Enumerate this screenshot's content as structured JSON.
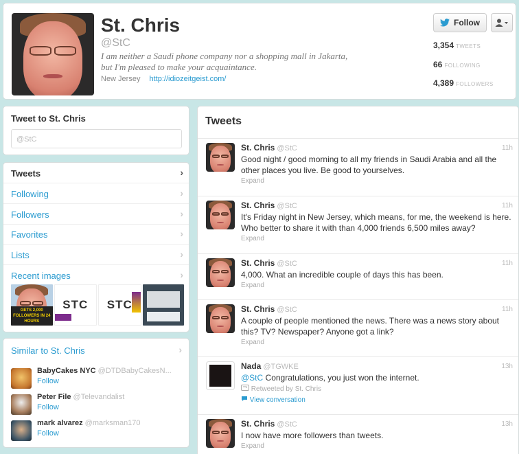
{
  "profile": {
    "name": "St. Chris",
    "handle": "@StC",
    "bio_line1": "I am neither a Saudi phone company nor a shopping mall in Jakarta,",
    "bio_line2": "but I'm pleased to make your acquaintance.",
    "location": "New Jersey",
    "url": "http://idiozeitgeist.com/",
    "follow_label": "Follow",
    "stats": [
      {
        "num": "3,354",
        "label": "TWEETS"
      },
      {
        "num": "66",
        "label": "FOLLOWING"
      },
      {
        "num": "4,389",
        "label": "FOLLOWERS"
      }
    ]
  },
  "tweet_to": {
    "title": "Tweet to St. Chris",
    "placeholder": "@StC"
  },
  "nav": {
    "items": [
      {
        "label": "Tweets"
      },
      {
        "label": "Following"
      },
      {
        "label": "Followers"
      },
      {
        "label": "Favorites"
      },
      {
        "label": "Lists"
      },
      {
        "label": "Recent images"
      }
    ],
    "thumb_texts": [
      "GETS 2,000 FOLLOWERS IN 24 HOURS",
      "STC",
      "STC"
    ]
  },
  "similar": {
    "title": "Similar to St. Chris",
    "people": [
      {
        "name": "BabyCakes NYC",
        "handle": "@DTDBabyCakesN...",
        "follow": "Follow"
      },
      {
        "name": "Peter File",
        "handle": "@Televandalist",
        "follow": "Follow"
      },
      {
        "name": "mark alvarez",
        "handle": "@marksman170",
        "follow": "Follow"
      }
    ]
  },
  "tweets": {
    "header": "Tweets",
    "list": [
      {
        "name": "St. Chris",
        "handle": "@StC",
        "time": "11h",
        "text": "Good night / good morning to all my friends in Saudi Arabia and all the other places you live. Be good to yourselves.",
        "expand": "Expand"
      },
      {
        "name": "St. Chris",
        "handle": "@StC",
        "time": "11h",
        "text": "It's Friday night in New Jersey, which means, for me, the weekend is here. Who better to share it with than 4,000 friends 6,500 miles away?",
        "expand": "Expand"
      },
      {
        "name": "St. Chris",
        "handle": "@StC",
        "time": "11h",
        "text": "4,000. What an incredible couple of days this has been.",
        "expand": "Expand"
      },
      {
        "name": "St. Chris",
        "handle": "@StC",
        "time": "11h",
        "text": "A couple of people mentioned the news. There was a news story about this? TV? Newspaper? Anyone got a link?",
        "expand": "Expand"
      },
      {
        "name": "Nada",
        "handle": "@TGWKE",
        "time": "13h",
        "mention": "@StC",
        "text": "Congratulations, you just won the internet.",
        "retweeted": "Retweeted by St. Chris",
        "conversation": "View conversation"
      },
      {
        "name": "St. Chris",
        "handle": "@StC",
        "time": "13h",
        "text": "I now have more followers than tweets.",
        "expand": "Expand"
      }
    ]
  }
}
